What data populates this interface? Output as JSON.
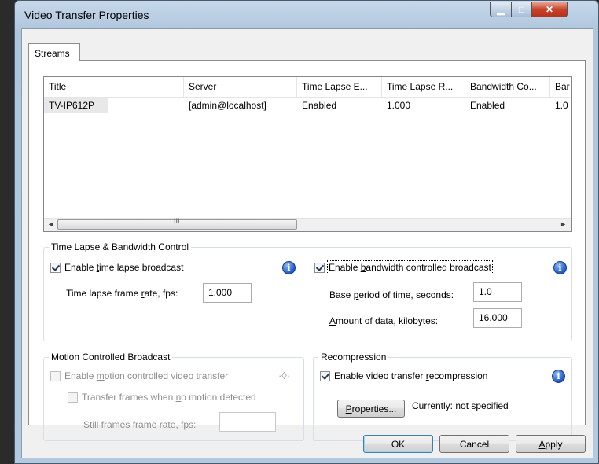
{
  "window": {
    "title": "Video Transfer Properties",
    "minimize_glyph": "▁",
    "maximize_glyph": "□",
    "close_glyph": "✕"
  },
  "tabs": [
    {
      "label": "Streams",
      "selected": true
    }
  ],
  "streams_table": {
    "columns": [
      "Title",
      "Server",
      "Time Lapse E...",
      "Time Lapse R...",
      "Bandwidth Co...",
      "Bar"
    ],
    "rows": [
      {
        "title": "TV-IP612P",
        "server": "[admin@localhost]",
        "time_lapse_enabled": "Enabled",
        "time_lapse_rate": "1.000",
        "bandwidth_control": "Enabled",
        "bandwidth_extra": "1.0"
      }
    ],
    "scroll_left": "◄",
    "scroll_right": "►",
    "scroll_grip": "III"
  },
  "time_lapse_group": {
    "title": "Time Lapse & Bandwidth Control",
    "enable_time_lapse": {
      "label_pre": "Enable ",
      "label_u": "t",
      "label_post": "ime lapse broadcast",
      "checked": true
    },
    "frame_rate_label_pre": "Time lapse frame ",
    "frame_rate_label_u": "r",
    "frame_rate_label_post": "ate, fps:",
    "frame_rate_value": "1.000",
    "enable_bandwidth": {
      "label_pre": "Enable ",
      "label_u": "b",
      "label_post": "andwidth controlled broadcast",
      "checked": true
    },
    "base_period_label_pre": "Base ",
    "base_period_label_u": "p",
    "base_period_label_post": "eriod of time, seconds:",
    "base_period_value": "1.0",
    "amount_label_pre": "",
    "amount_label_u": "A",
    "amount_label_post": "mount of data, kilobytes:",
    "amount_value": "16.000",
    "info_glyph": "i"
  },
  "motion_group": {
    "title": "Motion Controlled Broadcast",
    "enable_motion": {
      "label_pre": "Enable ",
      "label_u": "m",
      "label_post": "otion controlled video transfer",
      "checked": false
    },
    "transfer_frames": {
      "label_pre": "Transfer frames when ",
      "label_u": "n",
      "label_post": "o motion detected",
      "checked": false
    },
    "still_rate_label_pre": "",
    "still_rate_label_u": "S",
    "still_rate_label_post": "till frames frame rate, fps:",
    "still_rate_value": "",
    "motion_glyph": "·◊·"
  },
  "recompression_group": {
    "title": "Recompression",
    "enable_recompression": {
      "label_pre": "Enable video transfer ",
      "label_u": "r",
      "label_post": "ecompression",
      "checked": true
    },
    "properties_pre": "",
    "properties_u": "P",
    "properties_post": "roperties...",
    "status": "Currently: not specified",
    "info_glyph": "i"
  },
  "footer": {
    "ok": "OK",
    "cancel": "Cancel",
    "apply_u": "A",
    "apply_post": "pply"
  }
}
